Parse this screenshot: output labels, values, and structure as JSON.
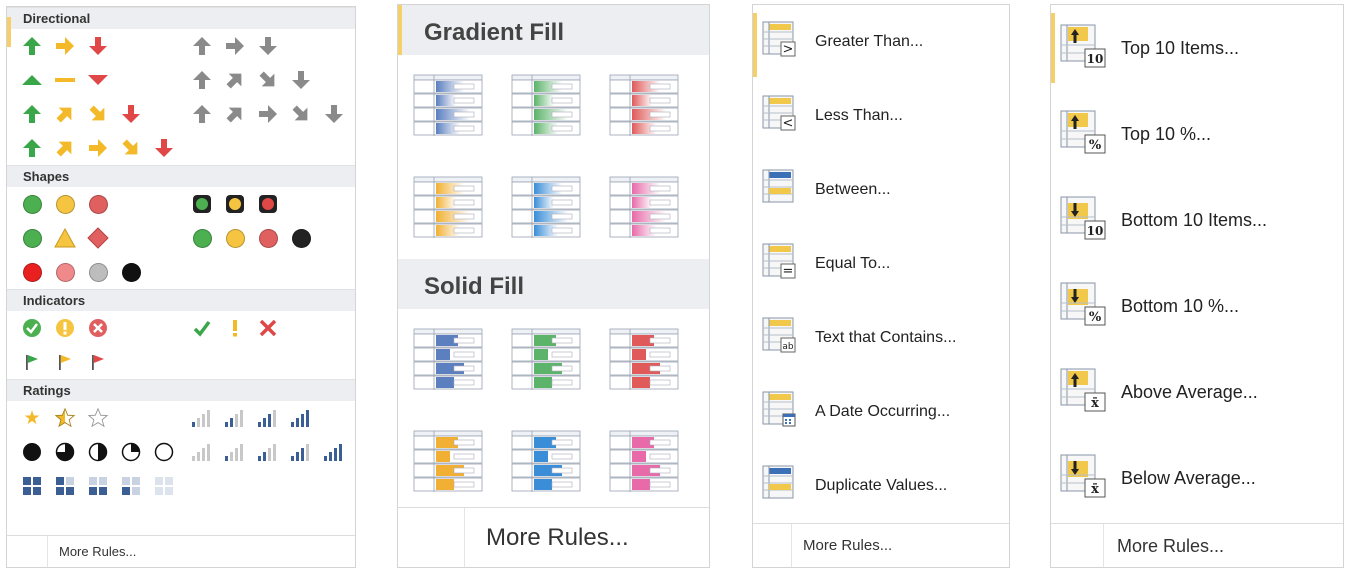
{
  "icon_sets": {
    "sections": {
      "directional": "Directional",
      "shapes": "Shapes",
      "indicators": "Indicators",
      "ratings": "Ratings"
    },
    "more_rules": "More Rules...",
    "colors": {
      "green": "#3aa64a",
      "yellow": "#f3b928",
      "red": "#e04848",
      "gray": "#8a8a8a",
      "blue": "#3b5f95"
    }
  },
  "data_bars": {
    "gradient_header": "Gradient Fill",
    "solid_header": "Solid Fill",
    "more_rules": "More Rules...",
    "colors": [
      "#5b7fbf",
      "#5cb36a",
      "#e05a5a",
      "#f1b033",
      "#3a8ed8",
      "#e86aa8"
    ]
  },
  "highlight_rules": {
    "items": [
      {
        "label": "Greater Than...",
        "icon": "greater-than-icon",
        "symbol": ">"
      },
      {
        "label": "Less Than...",
        "icon": "less-than-icon",
        "symbol": "<"
      },
      {
        "label": "Between...",
        "icon": "between-icon",
        "symbol": ""
      },
      {
        "label": "Equal To...",
        "icon": "equal-to-icon",
        "symbol": "="
      },
      {
        "label": "Text that Contains...",
        "icon": "text-contains-icon",
        "symbol": "ab"
      },
      {
        "label": "A Date Occurring...",
        "icon": "date-occurring-icon",
        "symbol": "cal"
      },
      {
        "label": "Duplicate Values...",
        "icon": "duplicate-values-icon",
        "symbol": ""
      }
    ],
    "more_rules": "More Rules..."
  },
  "top_bottom_rules": {
    "items": [
      {
        "label": "Top 10 Items...",
        "icon": "top-10-items-icon",
        "badge": "10",
        "dir": "up"
      },
      {
        "label": "Top 10 %...",
        "icon": "top-10-percent-icon",
        "badge": "%",
        "dir": "up"
      },
      {
        "label": "Bottom 10 Items...",
        "icon": "bottom-10-items-icon",
        "badge": "10",
        "dir": "down"
      },
      {
        "label": "Bottom 10 %...",
        "icon": "bottom-10-percent-icon",
        "badge": "%",
        "dir": "down"
      },
      {
        "label": "Above Average...",
        "icon": "above-average-icon",
        "badge": "x̄",
        "dir": "up"
      },
      {
        "label": "Below Average...",
        "icon": "below-average-icon",
        "badge": "x̄",
        "dir": "down"
      }
    ],
    "more_rules": "More Rules..."
  }
}
